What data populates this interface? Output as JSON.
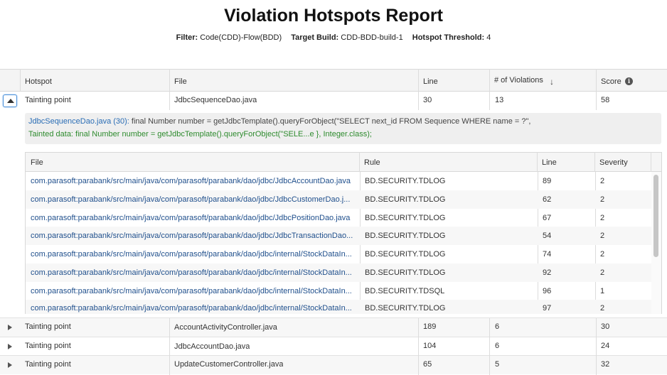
{
  "title": "Violation Hotspots Report",
  "filters": {
    "filter_label": "Filter:",
    "filter_value": "Code(CDD)-Flow(BDD)",
    "build_label": "Target Build:",
    "build_value": "CDD-BDD-build-1",
    "threshold_label": "Hotspot Threshold:",
    "threshold_value": "4"
  },
  "main_table": {
    "columns": [
      "Hotspot",
      "File",
      "Line",
      "# of Violations",
      "Score"
    ],
    "sort_icon": "arrow-down-icon",
    "info_icon": "info-icon",
    "expanded_row": {
      "hotspot": "Tainting point",
      "file": "JdbcSequenceDao.java",
      "line": "30",
      "violations": "13",
      "score": "58"
    },
    "detail": {
      "location": "JdbcSequenceDao.java (30):",
      "code": " final Number number = getJdbcTemplate().queryForObject(\"SELECT next_id FROM Sequence WHERE name = ?\",",
      "tainted": "Tainted data: final Number number = getJdbcTemplate().queryForObject(\"SELE...e }, Integer.class);"
    },
    "rows": [
      {
        "hotspot": "Tainting point",
        "file": "AccountActivityController.java",
        "line": "189",
        "violations": "6",
        "score": "30"
      },
      {
        "hotspot": "Tainting point",
        "file": "JdbcAccountDao.java",
        "line": "104",
        "violations": "6",
        "score": "24"
      },
      {
        "hotspot": "Tainting point",
        "file": "UpdateCustomerController.java",
        "line": "65",
        "violations": "5",
        "score": "32"
      }
    ]
  },
  "sub_table": {
    "columns": [
      "File",
      "Rule",
      "Line",
      "Severity"
    ],
    "rows": [
      {
        "file": "com.parasoft:parabank/src/main/java/com/parasoft/parabank/dao/jdbc/JdbcAccountDao.java",
        "rule": "BD.SECURITY.TDLOG",
        "line": "89",
        "severity": "2"
      },
      {
        "file": "com.parasoft:parabank/src/main/java/com/parasoft/parabank/dao/jdbc/JdbcCustomerDao.j...",
        "rule": "BD.SECURITY.TDLOG",
        "line": "62",
        "severity": "2"
      },
      {
        "file": "com.parasoft:parabank/src/main/java/com/parasoft/parabank/dao/jdbc/JdbcPositionDao.java",
        "rule": "BD.SECURITY.TDLOG",
        "line": "67",
        "severity": "2"
      },
      {
        "file": "com.parasoft:parabank/src/main/java/com/parasoft/parabank/dao/jdbc/JdbcTransactionDao...",
        "rule": "BD.SECURITY.TDLOG",
        "line": "54",
        "severity": "2"
      },
      {
        "file": "com.parasoft:parabank/src/main/java/com/parasoft/parabank/dao/jdbc/internal/StockDataIn...",
        "rule": "BD.SECURITY.TDLOG",
        "line": "74",
        "severity": "2"
      },
      {
        "file": "com.parasoft:parabank/src/main/java/com/parasoft/parabank/dao/jdbc/internal/StockDataIn...",
        "rule": "BD.SECURITY.TDLOG",
        "line": "92",
        "severity": "2"
      },
      {
        "file": "com.parasoft:parabank/src/main/java/com/parasoft/parabank/dao/jdbc/internal/StockDataIn...",
        "rule": "BD.SECURITY.TDSQL",
        "line": "96",
        "severity": "1"
      },
      {
        "file": "com.parasoft:parabank/src/main/java/com/parasoft/parabank/dao/jdbc/internal/StockDataIn...",
        "rule": "BD.SECURITY.TDLOG",
        "line": "97",
        "severity": "2"
      }
    ]
  }
}
